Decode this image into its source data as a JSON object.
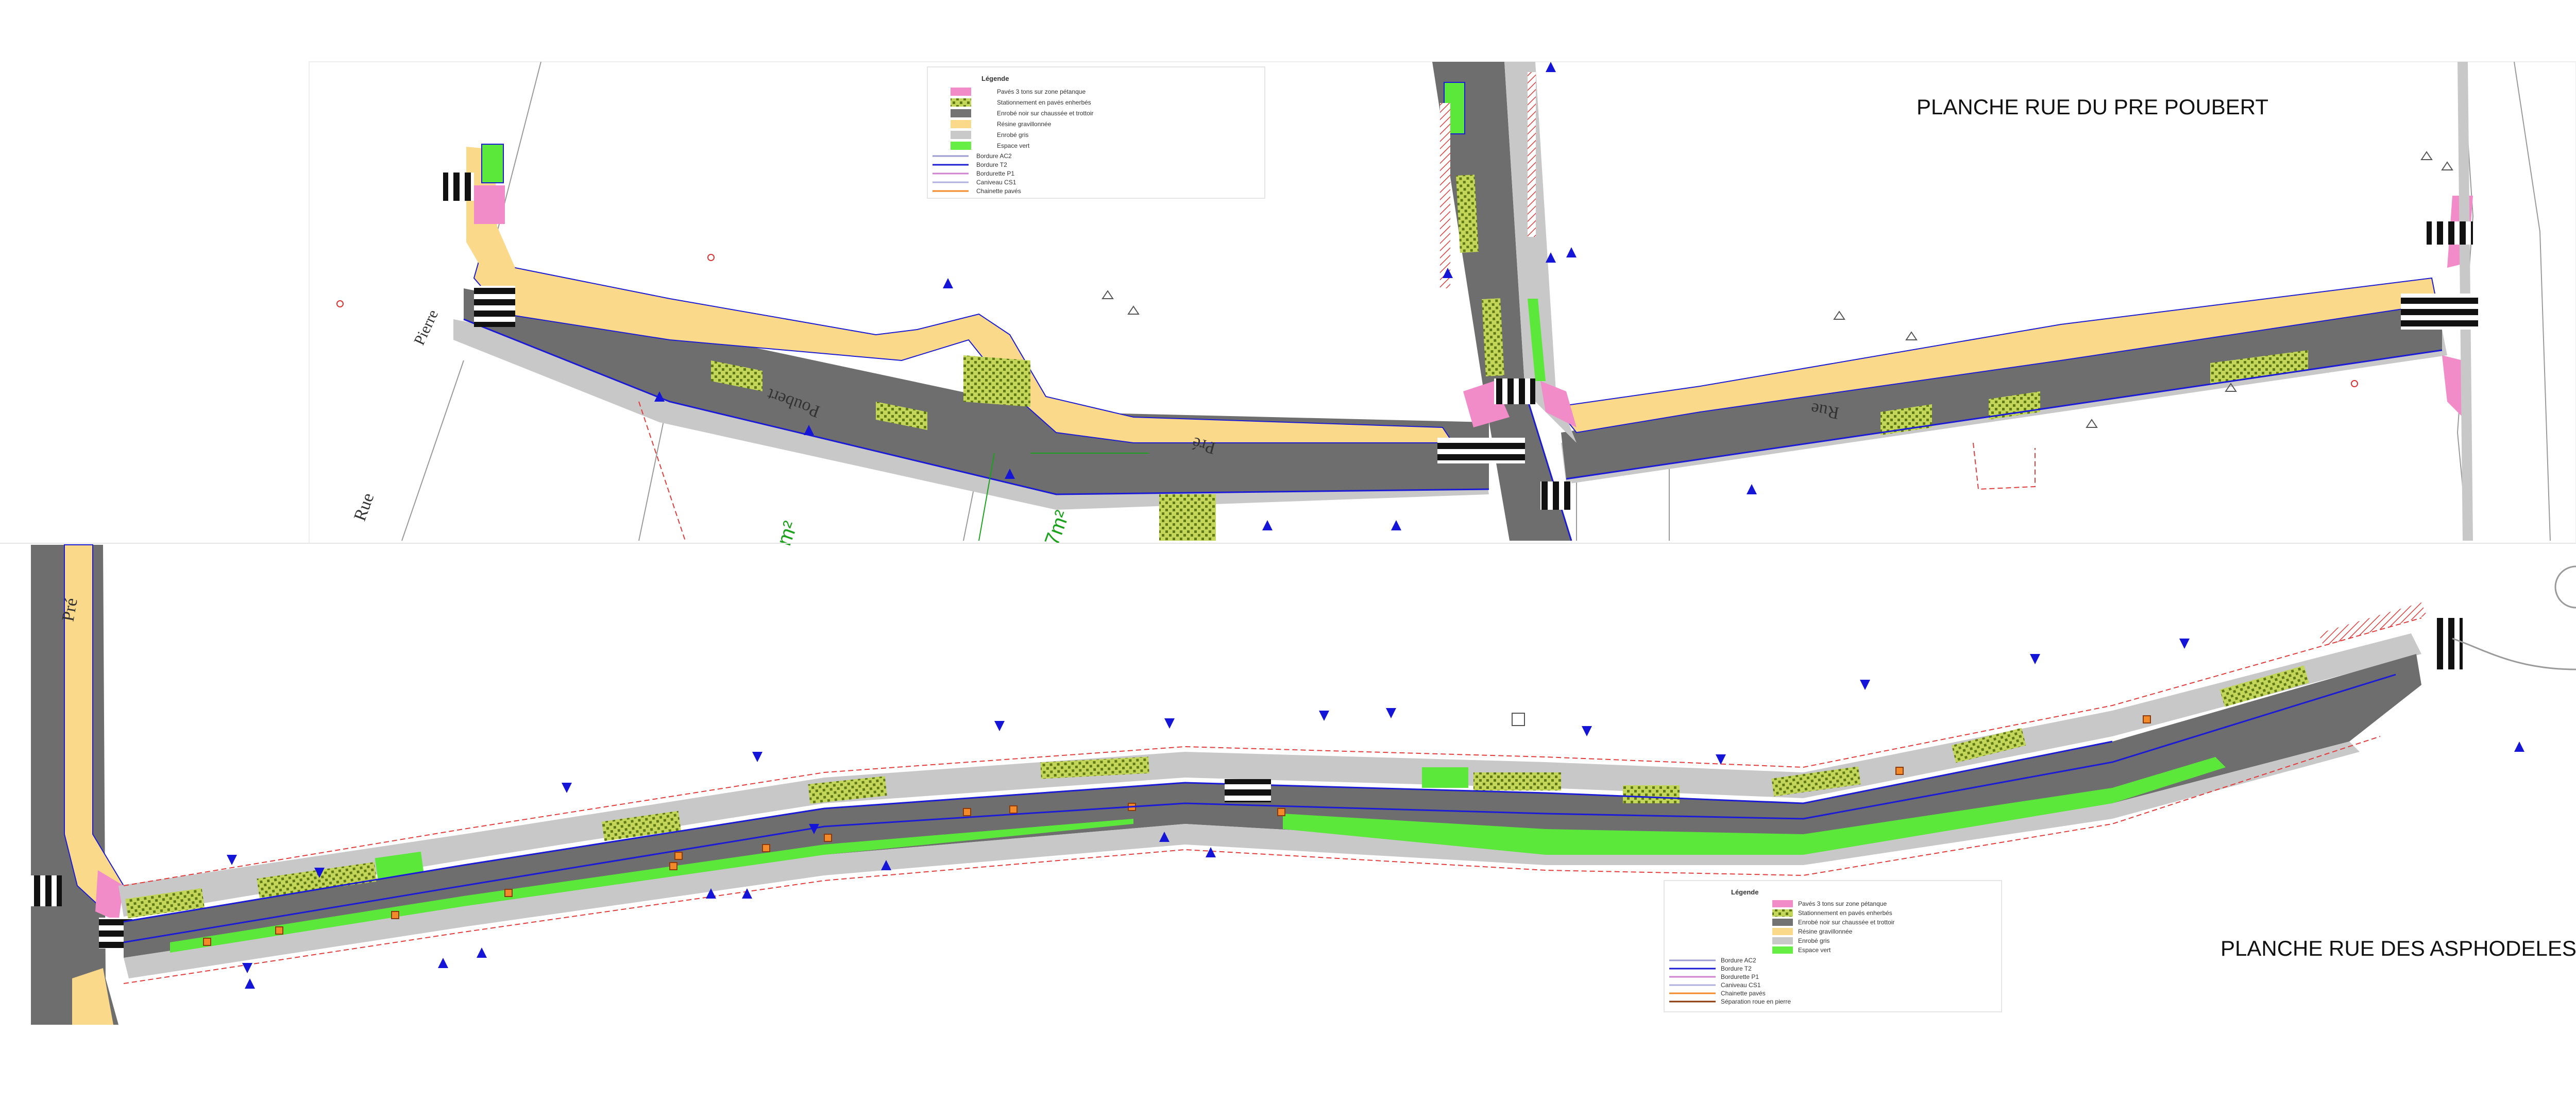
{
  "sheets": {
    "top_title": "PLANCHE RUE DU PRE POUBERT",
    "bottom_title": "PLANCHE RUE DES ASPHODELES"
  },
  "legend": {
    "title": "Légende",
    "fills": [
      {
        "label": "Pavés 3 tons sur zone pétanque",
        "color": "#f28cc8"
      },
      {
        "label": "Stationnement en pavés enherbés",
        "color": "#6b8e23",
        "pattern": true
      },
      {
        "label": "Enrobé noir sur chaussée et trottoir",
        "color": "#737373"
      },
      {
        "label": "Résine gravillonnée",
        "color": "#fbd98a"
      },
      {
        "label": "Enrobé gris",
        "color": "#c9c9c9"
      },
      {
        "label": "Espace vert",
        "color": "#66ee44"
      }
    ],
    "lines": [
      {
        "label": "Bordure AC2",
        "color": "#9c9cd4"
      },
      {
        "label": "Bordure T2",
        "color": "#1b1bd6"
      },
      {
        "label": "Bordurette P1",
        "color": "#d080d0"
      },
      {
        "label": "Caniveau CS1",
        "color": "#b0b0e0"
      },
      {
        "label": "Chainette pavés",
        "color": "#f28a2a"
      }
    ],
    "extra_line": {
      "label": "Séparation roue en pierre",
      "color": "#8b3a0e"
    }
  },
  "street_labels": {
    "poubert": "Poubert",
    "pre_top": "Pré",
    "rue_right": "Rue",
    "rue_left": "Rue",
    "pierre": "Pierre",
    "pre_left": "Pré"
  },
  "surface_labels": {
    "area_1": "m²",
    "area_2": "7m²"
  },
  "colors": {
    "road": "#6e6e6e",
    "sidewalk_grey": "#c8c8c8",
    "resin": "#fbd98a",
    "pavers_pink": "#f28cc8",
    "green": "#5be83b",
    "curb_blue": "#1b1bd6",
    "marker_blue": "#1515d8",
    "hatch_red": "#e23c3c"
  }
}
